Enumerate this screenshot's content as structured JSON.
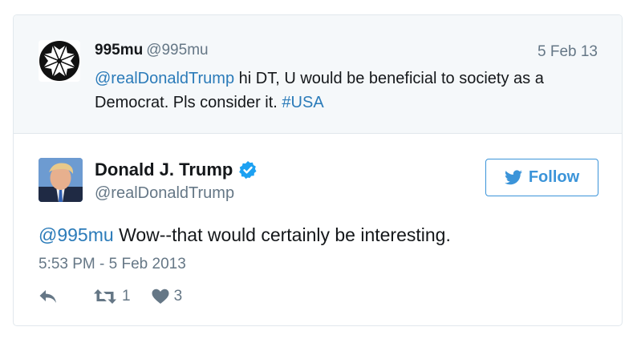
{
  "quoted": {
    "name": "995mu",
    "handle": "@995mu",
    "date": "5 Feb 13",
    "mention": "@realDonaldTrump",
    "text_part1": " hi DT, U would be beneficial to society as a Democrat. Pls consider it. ",
    "hashtag": "#USA",
    "avatar_icon": "white-maltese-cross-on-black-circle"
  },
  "tweet": {
    "name": "Donald J. Trump",
    "handle": "@realDonaldTrump",
    "verified_icon": "verified-badge-icon",
    "follow_label": "Follow",
    "mention": "@995mu",
    "text": " Wow--that would certainly be interesting.",
    "timestamp": "5:53 PM - 5 Feb 2013",
    "retweet_count": "1",
    "like_count": "3"
  },
  "colors": {
    "link": "#2b7bb9",
    "muted": "#657786",
    "follow": "#3b94d9",
    "verified": "#1da1f2",
    "quoted_bg": "#f5f8fa"
  }
}
